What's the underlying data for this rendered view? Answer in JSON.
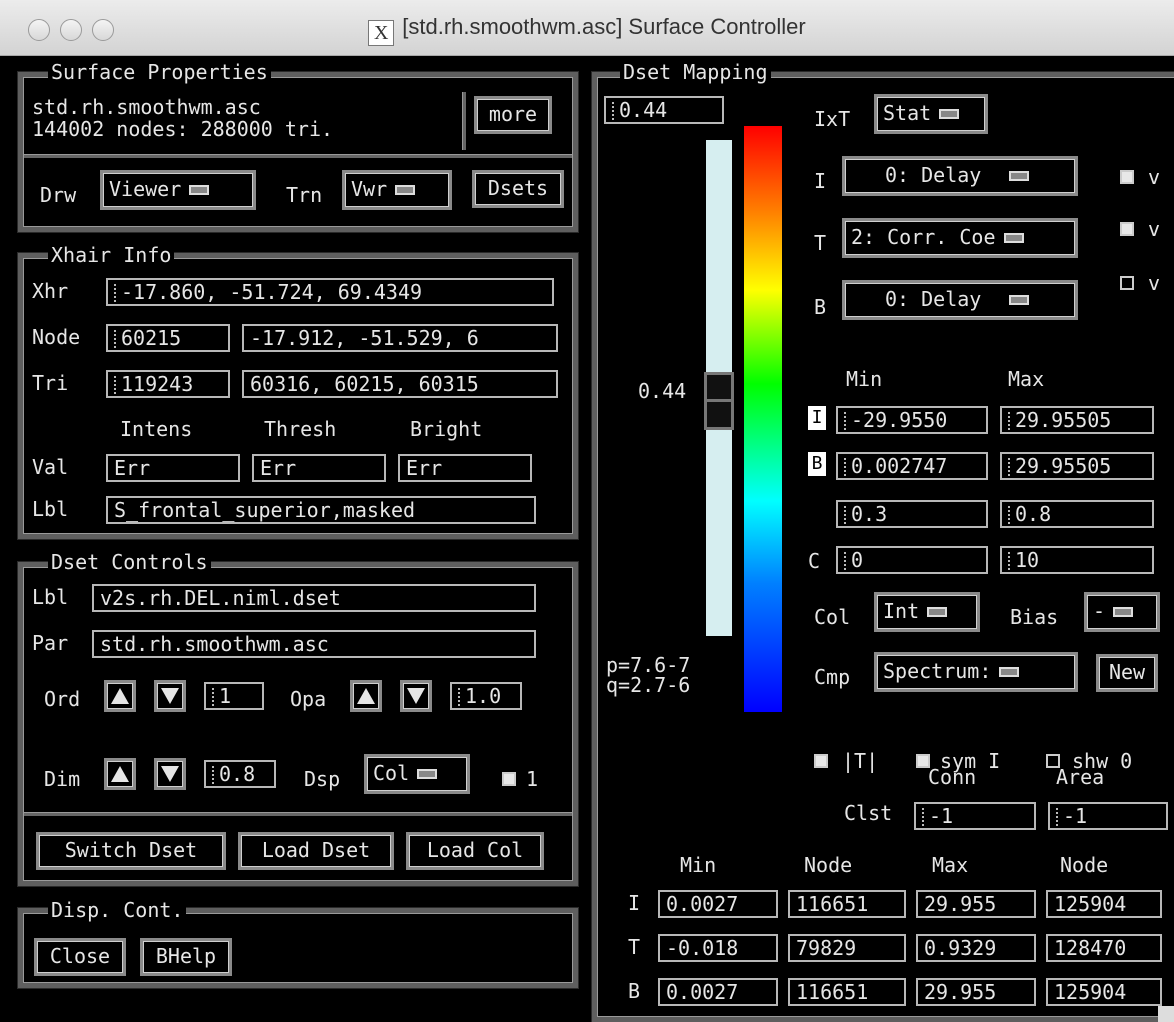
{
  "window": {
    "title": "[std.rh.smoothwm.asc] Surface Controller"
  },
  "surface_properties": {
    "title": "Surface Properties",
    "name": "std.rh.smoothwm.asc",
    "stats": "144002 nodes: 288000 tri.",
    "more_label": "more",
    "drw_label": "Drw",
    "drw_value": "Viewer",
    "trn_label": "Trn",
    "trn_value": "Vwr",
    "dsets_label": "Dsets"
  },
  "xhair": {
    "title": "Xhair Info",
    "xhr_label": "Xhr",
    "xhr_value": "-17.860, -51.724, 69.4349",
    "node_label": "Node",
    "node_value": "60215",
    "node_coords": "-17.912, -51.529, 6",
    "tri_label": "Tri",
    "tri_value": "119243",
    "tri_nodes": "60316, 60215, 60315",
    "col_intens": "Intens",
    "col_thresh": "Thresh",
    "col_bright": "Bright",
    "val_label": "Val",
    "val_intens": "Err",
    "val_thresh": "Err",
    "val_bright": "Err",
    "lbl_label": "Lbl",
    "lbl_value": "S_frontal_superior,masked"
  },
  "dset_controls": {
    "title": "Dset Controls",
    "lbl_label": "Lbl",
    "lbl_value": "v2s.rh.DEL.niml.dset",
    "par_label": "Par",
    "par_value": "std.rh.smoothwm.asc",
    "ord_label": "Ord",
    "ord_value": "1",
    "opa_label": "Opa",
    "opa_value": "1.0",
    "dim_label": "Dim",
    "dim_value": "0.8",
    "dsp_label": "Dsp",
    "dsp_value": "Col",
    "one_label": "1",
    "switch_label": "Switch Dset",
    "load_dset_label": "Load Dset",
    "load_col_label": "Load Col"
  },
  "disp_cont": {
    "title": "Disp. Cont.",
    "close_label": "Close",
    "bhelp_label": "BHelp"
  },
  "dset_mapping": {
    "title": "Dset Mapping",
    "threshold_value": "0.44",
    "slider_label": "0.44",
    "p_value": "p=7.6-7",
    "q_value": "q=2.7-6",
    "ixt_label": "IxT",
    "ixt_value": "Stat",
    "i_label": "I",
    "i_value": "0: Delay",
    "t_label": "T",
    "t_value": "2: Corr. Coe",
    "b_label": "B",
    "b_value": "0: Delay",
    "v_label": "v",
    "min_header": "Min",
    "max_header": "Max",
    "i_min": "-29.9550",
    "i_max": "29.95505",
    "b_min": "0.002747",
    "b_max": "29.95505",
    "range_min": "0.3",
    "range_max": "0.8",
    "c_label": "C",
    "c_min": "0",
    "c_max": "10",
    "col_label": "Col",
    "col_value": "Int",
    "bias_label": "Bias",
    "bias_value": "-",
    "cmp_label": "Cmp",
    "cmp_value": "Spectrum:",
    "new_label": "New",
    "iti_label": "|T|",
    "sym_label": "sym I",
    "shw_label": "shw 0",
    "conn_label": "Conn",
    "area_label": "Area",
    "clst_label": "Clst",
    "clst_conn": "-1",
    "clst_area": "-1",
    "table_headers": [
      "Min",
      "Node",
      "Max",
      "Node"
    ],
    "table_rows": [
      {
        "label": "I",
        "cells": [
          "0.0027",
          "116651",
          "29.955",
          "125904"
        ]
      },
      {
        "label": "T",
        "cells": [
          "-0.018",
          "79829",
          "0.9329",
          "128470"
        ]
      },
      {
        "label": "B",
        "cells": [
          "0.0027",
          "116651",
          "29.955",
          "125904"
        ]
      }
    ],
    "slider_fraction": 0.44
  }
}
